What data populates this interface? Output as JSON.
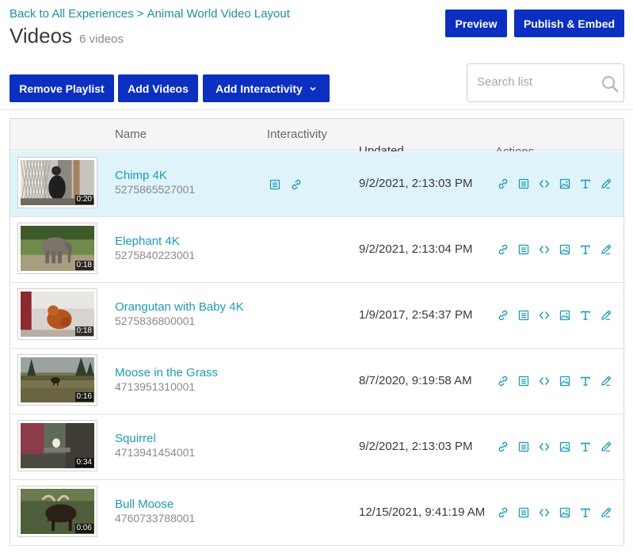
{
  "breadcrumb": {
    "back": "Back to All Experiences",
    "separator": ">",
    "current": "Animal World Video Layout"
  },
  "header": {
    "title": "Videos",
    "count": "6 videos"
  },
  "buttons": {
    "preview": "Preview",
    "publish": "Publish & Embed",
    "remove_playlist": "Remove Playlist",
    "add_videos": "Add Videos",
    "add_interactivity": "Add Interactivity"
  },
  "search": {
    "placeholder": "Search list"
  },
  "table": {
    "columns": {
      "name": "Name",
      "interactivity": "Interactivity",
      "updated": "Updated",
      "actions": "Actions"
    },
    "rows": [
      {
        "name": "Chimp 4K",
        "id": "5275865527001",
        "updated": "9/2/2021, 2:13:03 PM",
        "duration": "0:20",
        "selected": true,
        "interactivity": [
          "transcript-icon",
          "link-icon"
        ]
      },
      {
        "name": "Elephant 4K",
        "id": "5275840223001",
        "updated": "9/2/2021, 2:13:04 PM",
        "duration": "0:18",
        "selected": false,
        "interactivity": []
      },
      {
        "name": "Orangutan with Baby 4K",
        "id": "5275836800001",
        "updated": "1/9/2017, 2:54:37 PM",
        "duration": "0:18",
        "selected": false,
        "interactivity": []
      },
      {
        "name": "Moose in the Grass",
        "id": "4713951310001",
        "updated": "8/7/2020, 9:19:58 AM",
        "duration": "0:16",
        "selected": false,
        "interactivity": []
      },
      {
        "name": "Squirrel",
        "id": "4713941454001",
        "updated": "9/2/2021, 2:13:03 PM",
        "duration": "0:34",
        "selected": false,
        "interactivity": []
      },
      {
        "name": "Bull Moose",
        "id": "4760733788001",
        "updated": "12/15/2021, 9:41:19 AM",
        "duration": "0:06",
        "selected": false,
        "interactivity": []
      }
    ]
  },
  "action_icons": [
    "link-icon",
    "transcript-icon",
    "embed-code-icon",
    "image-icon",
    "text-icon",
    "edit-icon"
  ],
  "colors": {
    "primary_button": "#0b2fc0",
    "link": "#1e9ab8",
    "selected_row": "#dff3fb"
  }
}
